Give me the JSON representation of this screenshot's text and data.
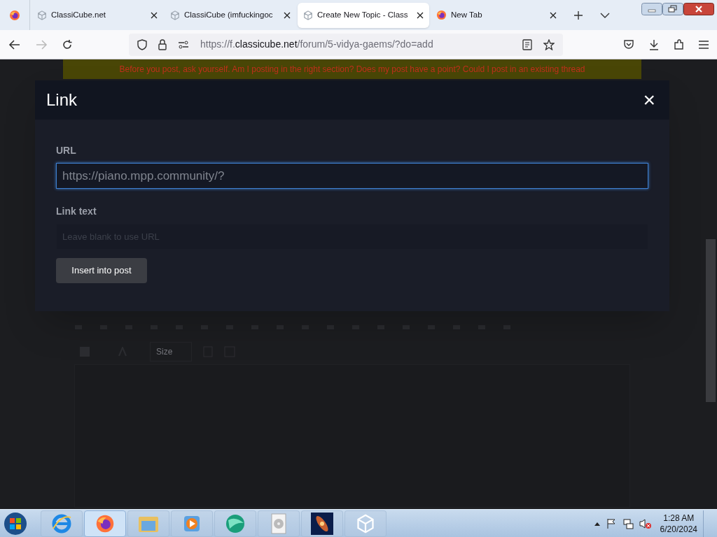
{
  "tabs": [
    {
      "title": "ClassiCube.net",
      "kind": "site",
      "selected": false
    },
    {
      "title": "ClassiCube (imfuckingoc",
      "kind": "site",
      "selected": false
    },
    {
      "title": "Create New Topic - Class",
      "kind": "site",
      "selected": true
    },
    {
      "title": "New Tab",
      "kind": "newtab",
      "selected": false
    }
  ],
  "address": {
    "prefix": "https://f.",
    "domain": "classicube.net",
    "path": "/forum/5-vidya-gaems/?do=add"
  },
  "banner": "Before you post, ask yourself. Am I posting in the right section? Does my post have a point? Could I post in an existing thread",
  "editor": {
    "size_label": "Size"
  },
  "dialog": {
    "title": "Link",
    "close": "×",
    "fields": [
      {
        "label": "URL",
        "value": "https://piano.mpp.community/?",
        "focused": true
      },
      {
        "label": "Link text",
        "placeholder": "Leave blank to use URL",
        "focused": false
      }
    ],
    "button": "Insert into post"
  },
  "taskbar": {
    "apps": [
      {
        "kind": "ie",
        "active": false
      },
      {
        "kind": "firefox",
        "active": true
      },
      {
        "kind": "folder",
        "active": false
      },
      {
        "kind": "media",
        "active": false
      },
      {
        "kind": "globe",
        "active": false
      },
      {
        "kind": "disc",
        "active": false
      },
      {
        "kind": "galaxy",
        "active": false
      },
      {
        "kind": "cube",
        "active": false
      }
    ],
    "time": "1:28 AM",
    "date": "6/20/2024"
  }
}
